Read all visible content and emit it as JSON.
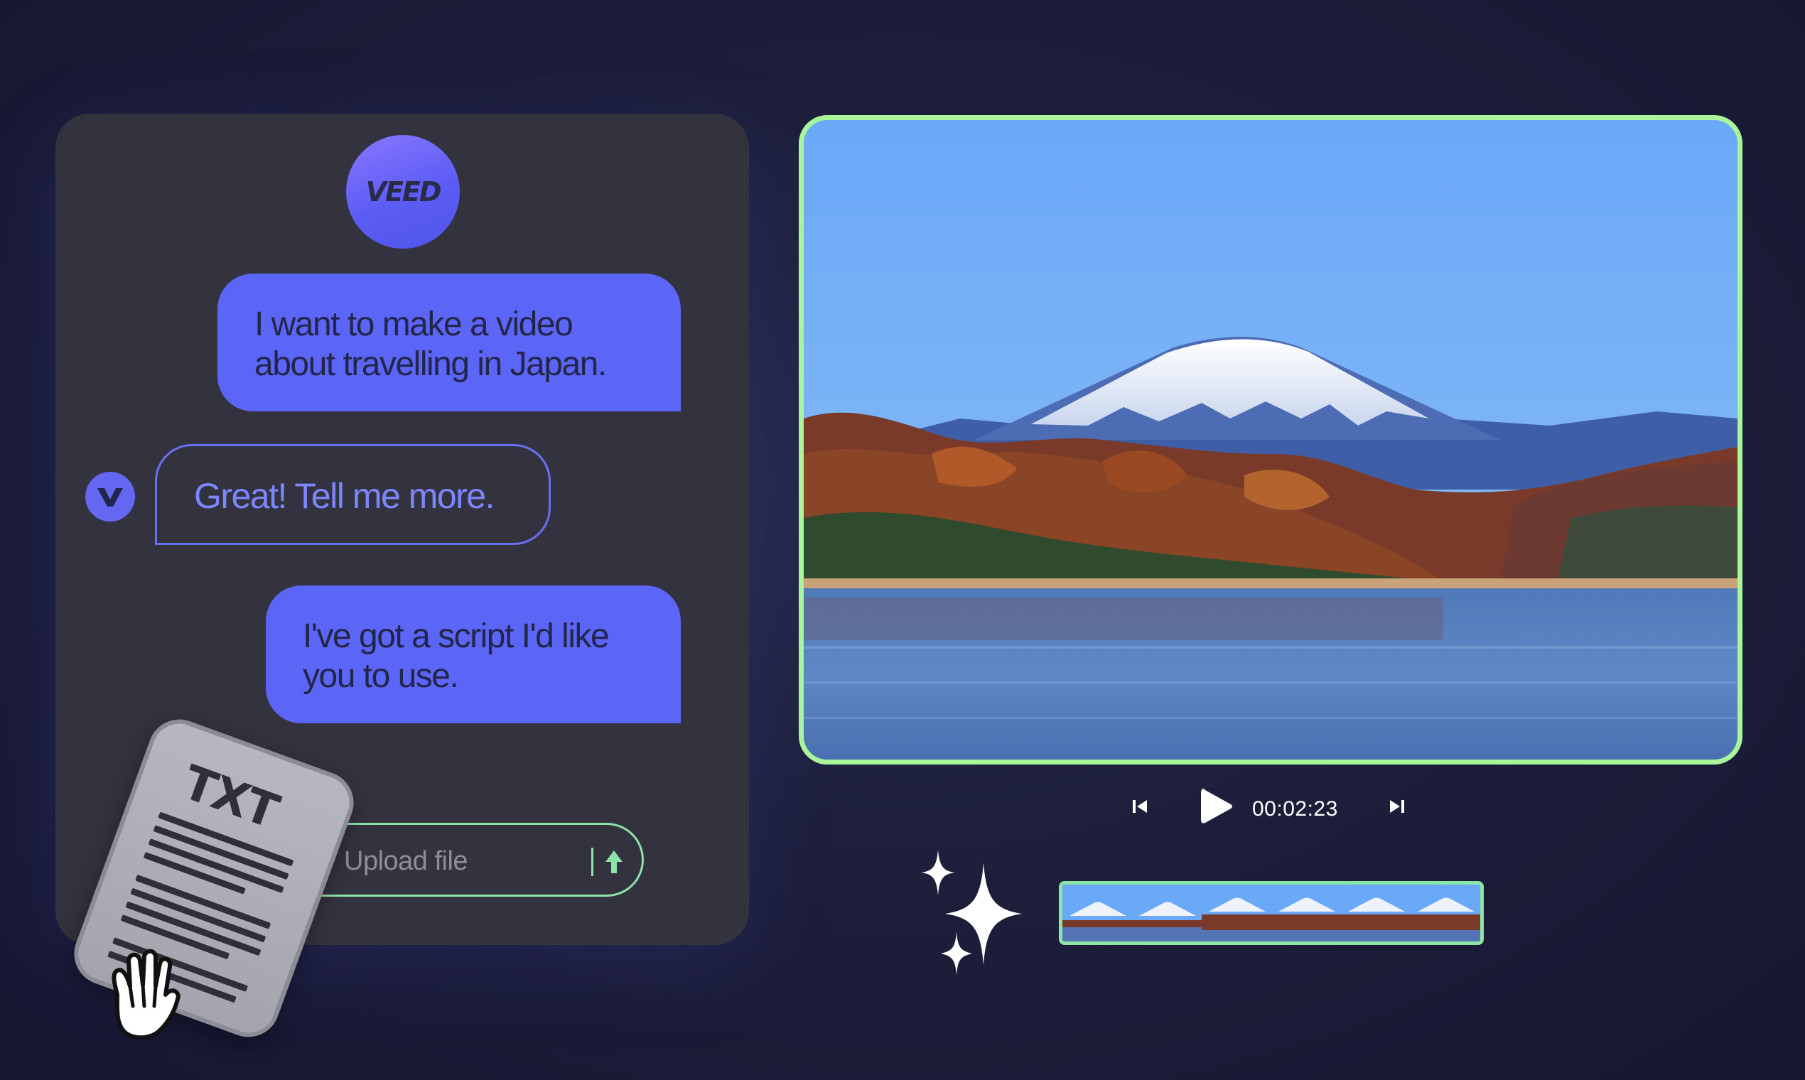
{
  "brand": {
    "logo_text": "VEED"
  },
  "chat": {
    "messages": [
      {
        "role": "user",
        "line1": "I want to make a video",
        "line2": "about travelling in Japan."
      },
      {
        "role": "assistant",
        "text": "Great! Tell me more."
      },
      {
        "role": "user",
        "line1": "I've got a script I'd like",
        "line2": "you to use."
      }
    ],
    "upload": {
      "placeholder": "Upload file",
      "icon": "upload-arrow-icon"
    },
    "attachment": {
      "file_type": "TXT",
      "icon": "document-icon",
      "cursor": "hand-grab-icon"
    }
  },
  "player": {
    "time": "00:02:23",
    "prev_icon": "skip-back-icon",
    "play_icon": "play-icon",
    "next_icon": "skip-forward-icon",
    "timeline_thumbnails": 6,
    "ai_icon": "sparkles-icon"
  },
  "colors": {
    "accent_blue": "#5b66f6",
    "accent_green": "#a9f59a",
    "panel": "#33333f",
    "background": "#1d1f3b"
  }
}
